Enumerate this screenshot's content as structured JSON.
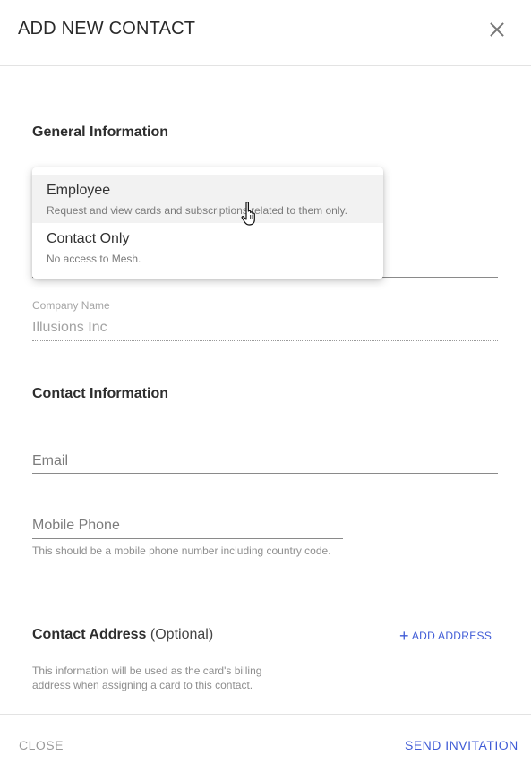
{
  "dialog": {
    "title": "ADD NEW CONTACT",
    "close_icon": "close-icon"
  },
  "general": {
    "heading": "General Information",
    "role_dropdown": {
      "options": [
        {
          "label": "Employee",
          "description": "Request and view cards and subscriptions related to them only.",
          "hovered": true
        },
        {
          "label": "Contact Only",
          "description": "No access to Mesh.",
          "hovered": false
        }
      ]
    },
    "company": {
      "label": "Company Name",
      "value": "Illusions Inc"
    }
  },
  "contact": {
    "heading": "Contact Information",
    "email_placeholder": "Email",
    "phone_placeholder": "Mobile Phone",
    "phone_helper": "This should be a mobile phone number including country code."
  },
  "address": {
    "heading": "Contact Address",
    "optional": "(Optional)",
    "add_label": "ADD ADDRESS",
    "add_icon": "plus-icon",
    "helper": "This information will be used as the card's billing address when assigning a card to this contact."
  },
  "footer": {
    "close_label": "CLOSE",
    "send_label": "SEND INVITATION"
  },
  "colors": {
    "accent": "#3f5bd6",
    "muted": "#9a9a9a"
  }
}
